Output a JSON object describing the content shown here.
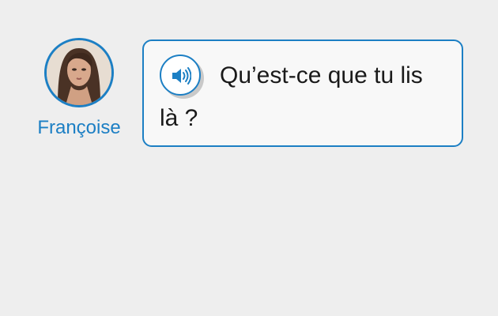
{
  "speaker": {
    "name": "Françoise"
  },
  "bubble": {
    "line_1": "Qu’est-ce que tu lis",
    "line_2": "là ?"
  },
  "colors": {
    "accent": "#1c7fc4",
    "background": "#eeeeee",
    "bubble_background": "#f8f8f8",
    "text": "#1a1a1a"
  },
  "icons": {
    "audio": "speaker-volume-icon"
  }
}
